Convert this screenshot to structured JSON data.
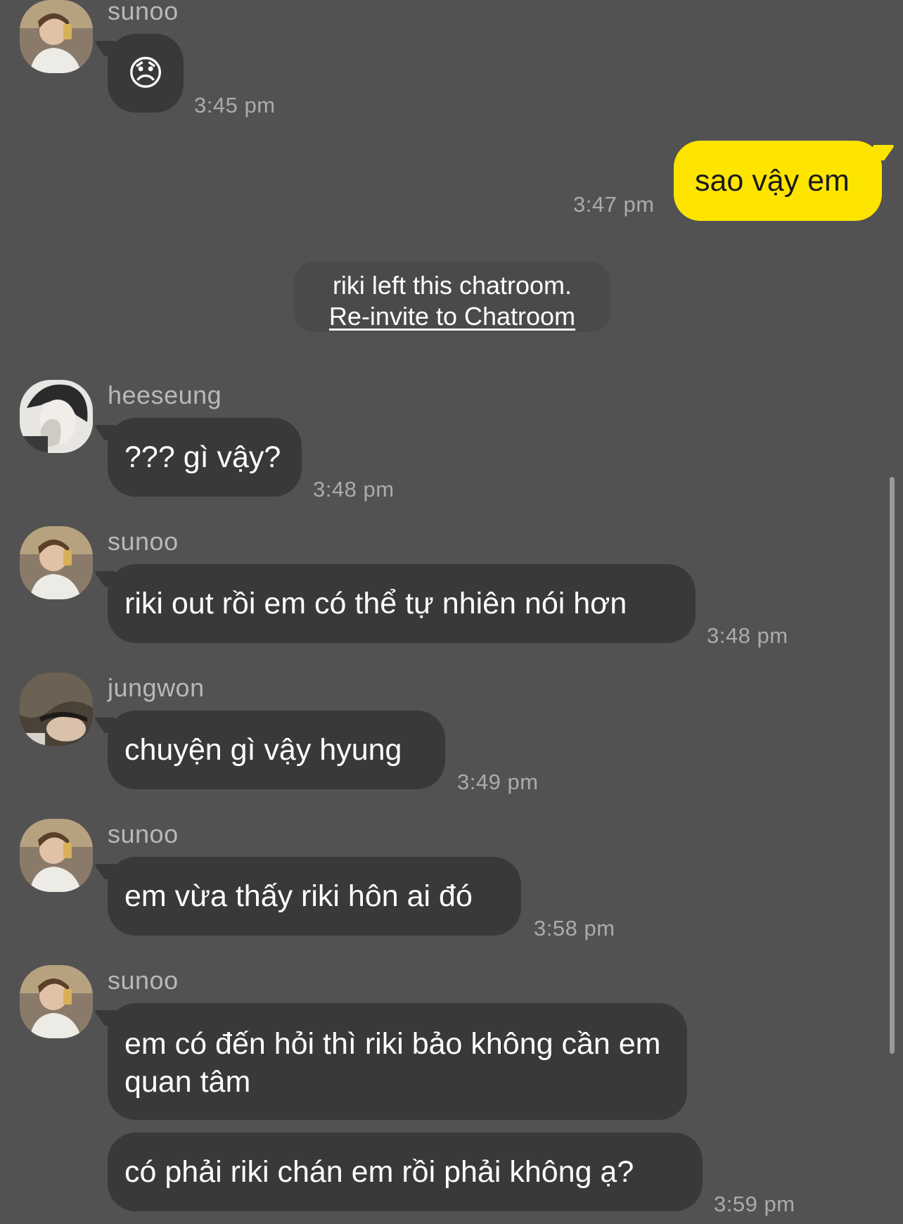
{
  "colors": {
    "background": "#535253",
    "incoming_bubble": "#3a393a",
    "outgoing_bubble": "#fee500"
  },
  "messages": [
    {
      "sender": "sunoo",
      "text": "😞",
      "time": "3:45 pm"
    },
    {
      "text": "sao vậy em",
      "time": "3:47 pm",
      "outgoing": true
    },
    {
      "sender": "heeseung",
      "text": "??? gì vậy?",
      "time": "3:48 pm"
    },
    {
      "sender": "sunoo",
      "text": "riki out rồi em có thể tự nhiên nói hơn",
      "time": "3:48 pm"
    },
    {
      "sender": "jungwon",
      "text": "chuyện gì vậy hyung",
      "time": "3:49 pm"
    },
    {
      "sender": "sunoo",
      "text": "em vừa thấy riki hôn ai đó",
      "time": "3:58 pm"
    },
    {
      "sender": "sunoo",
      "text": "em có đến hỏi thì riki bảo không cần em quan tâm",
      "text2": "có phải riki chán em rồi phải không ạ?",
      "time": "3:59 pm"
    }
  ],
  "notice": {
    "text": "riki left this chatroom.",
    "link": "Re-invite to Chatroom"
  }
}
